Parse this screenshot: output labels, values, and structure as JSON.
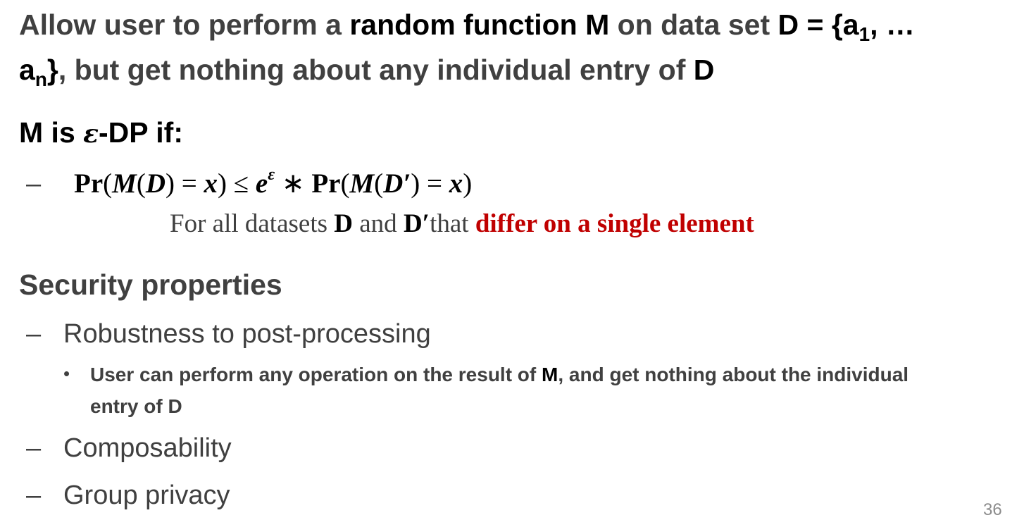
{
  "intro": {
    "p1": "Allow user to perform a ",
    "p2": "random function M",
    "p3": " on data set ",
    "p4": "D = {a",
    "sub1": "1",
    "p5": ", …",
    "p6": "a",
    "subn": "n",
    "p7": "}",
    "p8": ", but get nothing about any individual entry of ",
    "p9": "D"
  },
  "dp": {
    "m": "M",
    "is": " is ",
    "eps": "ε",
    "rest": "-DP if:"
  },
  "formula": {
    "dash": "–",
    "pr1": "Pr",
    "open1": "(",
    "m1": "M",
    "open2": "(",
    "d1": "D",
    "close2": ")",
    "eq1": " = ",
    "x1": "x",
    "close1": ")",
    "le": " ≤ ",
    "e": "e",
    "eps": "ε",
    "times": " ∗ ",
    "pr2": "Pr",
    "open3": "(",
    "m2": "M",
    "open4": "(",
    "d2": "D′",
    "close4": ")",
    "eq2": " = ",
    "x2": "x",
    "close3": ")"
  },
  "caption": {
    "pre": "For all datasets ",
    "d1": "D",
    "and": " and ",
    "d2": "D′",
    "that": "that ",
    "red": "differ on a single element"
  },
  "security": {
    "heading": "Security properties",
    "dash": "–",
    "item1": "Robustness to post-processing",
    "bullet": "•",
    "sub1a": "User can perform any operation on the result of ",
    "sub1b": "M",
    "sub1c": ", and get nothing about the individual",
    "sub2": "entry of D",
    "item2": "Composability",
    "item3": "Group privacy"
  },
  "page_number": "36",
  "colors": {
    "text": "#404040",
    "emphasis": "#000000",
    "red": "#c00000",
    "page_number": "#8c8c8c"
  }
}
